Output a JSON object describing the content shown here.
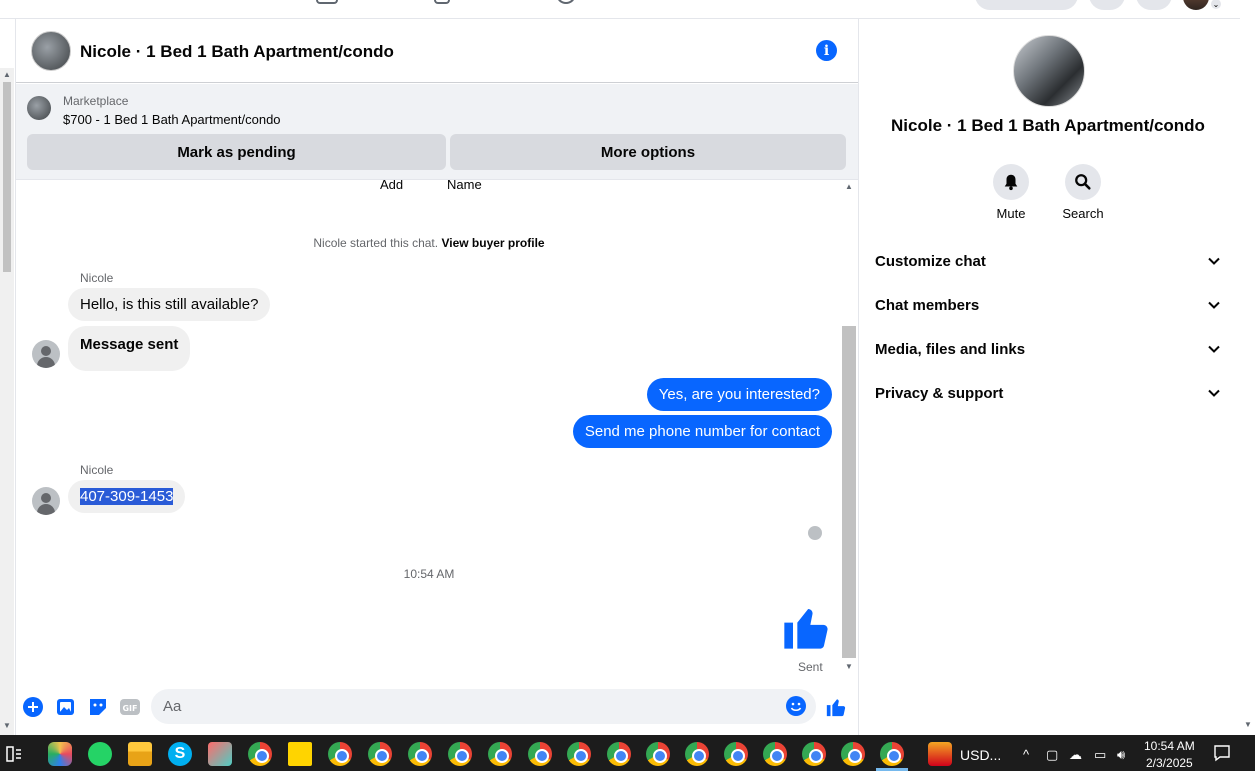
{
  "header": {
    "title": "Nicole · 1 Bed 1 Bath Apartment/condo"
  },
  "marketplace": {
    "label": "Marketplace",
    "item": "$700 - 1 Bed 1 Bath Apartment/condo",
    "mark_pending": "Mark as pending",
    "more_options": "More options"
  },
  "messages": {
    "cut_add": "Add",
    "cut_name": "Name",
    "system_started": "Nicole started this chat.",
    "view_buyer_profile": "View buyer profile",
    "sender1": "Nicole",
    "msg1": "Hello, is this still available?",
    "msg2": "Message sent",
    "out1": "Yes, are you interested?",
    "out2": "Send me phone number for contact",
    "sender2": "Nicole",
    "msg3": "407-309-1453",
    "time": "10:54 AM",
    "sent": "Sent"
  },
  "composer": {
    "placeholder": "Aa"
  },
  "side": {
    "title": "Nicole · 1 Bed 1 Bath Apartment/condo",
    "mute": "Mute",
    "search": "Search",
    "sections": [
      "Customize chat",
      "Chat members",
      "Media, files and links",
      "Privacy & support"
    ]
  },
  "taskbar": {
    "currency": "USD...",
    "time": "10:54 AM",
    "date": "2/3/2025"
  },
  "colors": {
    "messenger_blue": "#0866ff",
    "bubble_gray": "#f0f0f0",
    "selection": "#2a5bd7"
  }
}
